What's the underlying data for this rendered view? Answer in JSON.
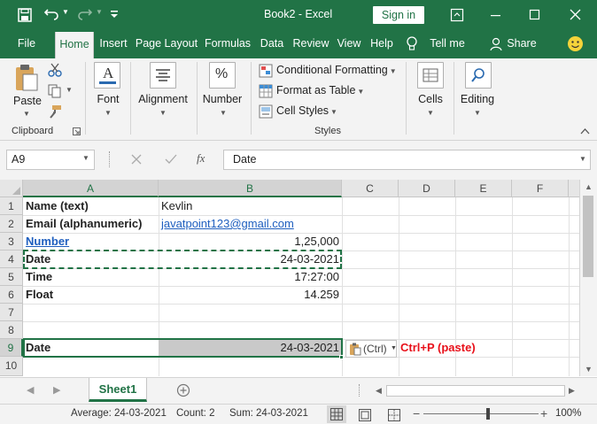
{
  "window": {
    "title": "Book2  -  Excel",
    "signin": "Sign in"
  },
  "tabs": [
    {
      "label": "File"
    },
    {
      "label": "Home"
    },
    {
      "label": "Insert"
    },
    {
      "label": "Page Layout"
    },
    {
      "label": "Formulas"
    },
    {
      "label": "Data"
    },
    {
      "label": "Review"
    },
    {
      "label": "View"
    },
    {
      "label": "Help"
    },
    {
      "label": "Tell me"
    },
    {
      "label": "Share"
    }
  ],
  "ribbon": {
    "paste": "Paste",
    "clipboard": "Clipboard",
    "font": "Font",
    "alignment": "Alignment",
    "number": "Number",
    "conditional": "Conditional Formatting",
    "format_table": "Format as Table",
    "cell_styles": "Cell Styles",
    "styles": "Styles",
    "cells": "Cells",
    "editing": "Editing",
    "font_glyph": "A",
    "number_glyph": "%"
  },
  "formula_bar": {
    "name_box": "A9",
    "fx": "fx",
    "value": "Date"
  },
  "columns": [
    "A",
    "B",
    "C",
    "D",
    "E",
    "F"
  ],
  "rows": [
    "1",
    "2",
    "3",
    "4",
    "5",
    "6",
    "7",
    "8",
    "9",
    "10"
  ],
  "cells": {
    "a1": "Name (text)",
    "b1": "Kevlin",
    "a2": "Email (alphanumeric)",
    "b2": "javatpoint123@gmail.com",
    "a3": "Number",
    "b3": "1,25,000",
    "a4": "Date",
    "b4": "24-03-2021",
    "a5": "Time",
    "b5": "17:27:00",
    "a6": "Float",
    "b6": "14.259",
    "a9": "Date",
    "b9": "24-03-2021"
  },
  "paste_options": {
    "label": "(Ctrl)"
  },
  "annotation": {
    "text": "Ctrl+P (paste)",
    "color": "#e8101a"
  },
  "sheet": {
    "tab": "Sheet1"
  },
  "status": {
    "average": "Average: 24-03-2021",
    "count": "Count: 2",
    "sum": "Sum: 24-03-2021",
    "zoom": "100%"
  },
  "colors": {
    "brand": "#217346",
    "link": "#1f5fbf"
  }
}
